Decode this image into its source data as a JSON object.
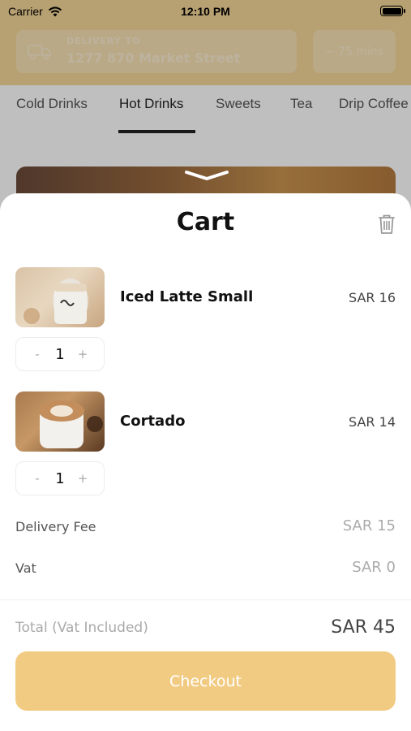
{
  "status_bar": {
    "carrier": "Carrier",
    "time": "12:10 PM"
  },
  "header": {
    "delivery_label": "DELIVERY TO",
    "delivery_address": "1277 870 Market Street",
    "eta": "~ 75 mins"
  },
  "tabs": [
    {
      "label": "Cold Drinks",
      "active": false
    },
    {
      "label": "Hot Drinks",
      "active": true
    },
    {
      "label": "Sweets",
      "active": false
    },
    {
      "label": "Tea",
      "active": false
    },
    {
      "label": "Drip Coffee",
      "active": false
    }
  ],
  "cart": {
    "title": "Cart",
    "items": [
      {
        "name": "Iced Latte Small",
        "price": "SAR 16",
        "quantity": "1",
        "decrement": "-",
        "increment": "+"
      },
      {
        "name": "Cortado",
        "price": "SAR 14",
        "quantity": "1",
        "decrement": "-",
        "increment": "+"
      }
    ],
    "summary": {
      "delivery_fee_label": "Delivery Fee",
      "delivery_fee_value": "SAR 15",
      "vat_label": "Vat",
      "vat_value": "SAR 0"
    },
    "total": {
      "label": "Total",
      "note": "(Vat Included)",
      "value": "SAR 45"
    },
    "checkout_label": "Checkout"
  },
  "colors": {
    "brand_yellow": "#f5d697",
    "checkout_button": "#f2cb83"
  }
}
